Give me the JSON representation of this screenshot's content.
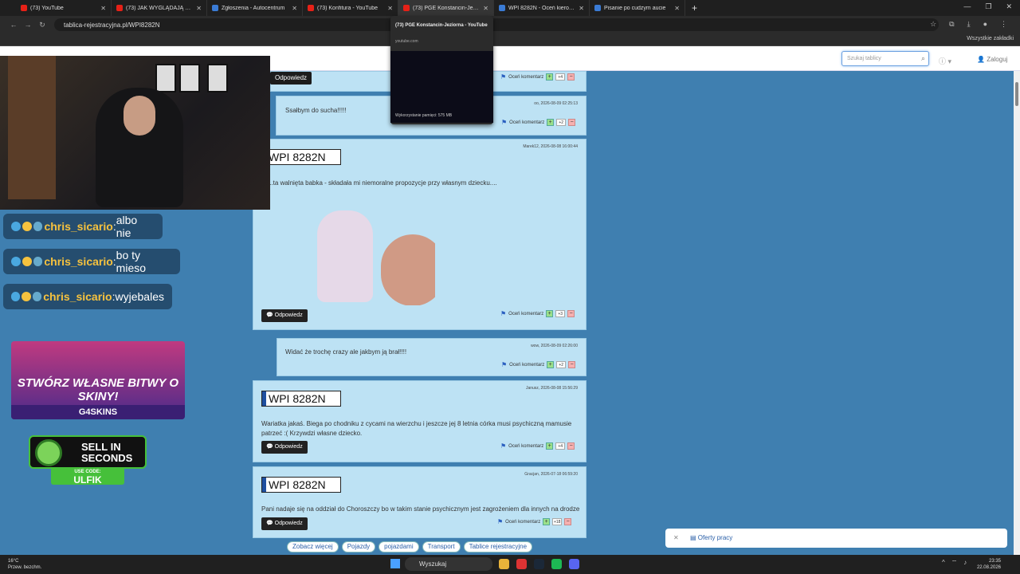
{
  "browser": {
    "tabs": [
      {
        "title": "(73) YouTube",
        "color": "#e62117"
      },
      {
        "title": "(73) JAK WYGLĄDAJĄ POLSKIE",
        "color": "#e62117"
      },
      {
        "title": "Zgłoszenia - Autocentrum",
        "color": "#3a7bd5"
      },
      {
        "title": "(73) Konfitura - YouTube",
        "color": "#e62117"
      },
      {
        "title": "(73) PGE Konstancin-Jeziorna",
        "color": "#e62117"
      },
      {
        "title": "WPI 8282N - Oceń kierowcę!",
        "color": "#3a7bd5"
      },
      {
        "title": "Pisanie po cudzym aucie",
        "color": "#3a7bd5"
      }
    ],
    "url": "tablica-rejestracyjna.pl/WPI8282N",
    "bookmarks_label": "Wszystkie zakładki",
    "tooltip": {
      "title": "(73) PGE Konstancin-Jeziorna - YouTube",
      "domain": "youtube.com",
      "memory": "Wykorzystanie pamięci: 575 MB"
    }
  },
  "header": {
    "search_placeholder": "Szukaj tablicy",
    "login": "Zaloguj"
  },
  "chat": [
    {
      "user": "chris_sicario",
      "text": "albo nie"
    },
    {
      "user": "chris_sicario",
      "text": "bo ty mieso"
    },
    {
      "user": "chris_sicario",
      "text": "wyjebales"
    }
  ],
  "promo": {
    "headline": "STWÓRZ WŁASNE BITWY O SKINY!",
    "brand": "G4SKINS",
    "sell_text": "SELL IN SECONDS",
    "code_label": "USE CODE:",
    "code": "ULFIK"
  },
  "comments": {
    "rate_label": "Oceń komentarz",
    "reply_label": "Odpowiedz",
    "plate": "WPI 8282N",
    "items": [
      {
        "meta": "",
        "text": "",
        "score": "+4"
      },
      {
        "meta": "oo, 2026-08-09 02:25:13",
        "text": "Ssałbym do sucha!!!!!",
        "score": "+2"
      },
      {
        "meta": "Marek12, 2026-08-08 16:00:44",
        "text": "...ta walnięta babka - składała mi niemoralne propozycje przy własnym dziecku....",
        "score": "+3"
      },
      {
        "meta": "wow, 2026-08-09 02:26:00",
        "text": "Widać że trochę crazy ale jakbym ją brał!!!!",
        "score": "+2"
      },
      {
        "meta": "Janusz, 2026-08-08 15:56:29",
        "text": "Wariatka jakaś. Biega po chodniku z cycami na wierzchu i jeszcze jej 8 letnia córka musi psychiczną mamusie patrzeć :( Krzywdzi własne dziecko.",
        "score": "+4"
      },
      {
        "meta": "Gracjan, 2026-07-18 06:59:20",
        "text": "Pani nadaje się na oddział do Choroszczy bo w takim stanie psychicznym jest zagrożeniem dla innych na drodze",
        "score": "+18"
      }
    ]
  },
  "tags": [
    "Zobacz więcej",
    "Pojazdy",
    "pojazdami",
    "Transport",
    "Tablice rejestracyjne"
  ],
  "offer": "Oferty pracy",
  "taskbar": {
    "weather_temp": "16°C",
    "weather_desc": "Przew. bezchm.",
    "search": "Wyszukaj",
    "time": "23:35",
    "date": "22.08.2026"
  }
}
